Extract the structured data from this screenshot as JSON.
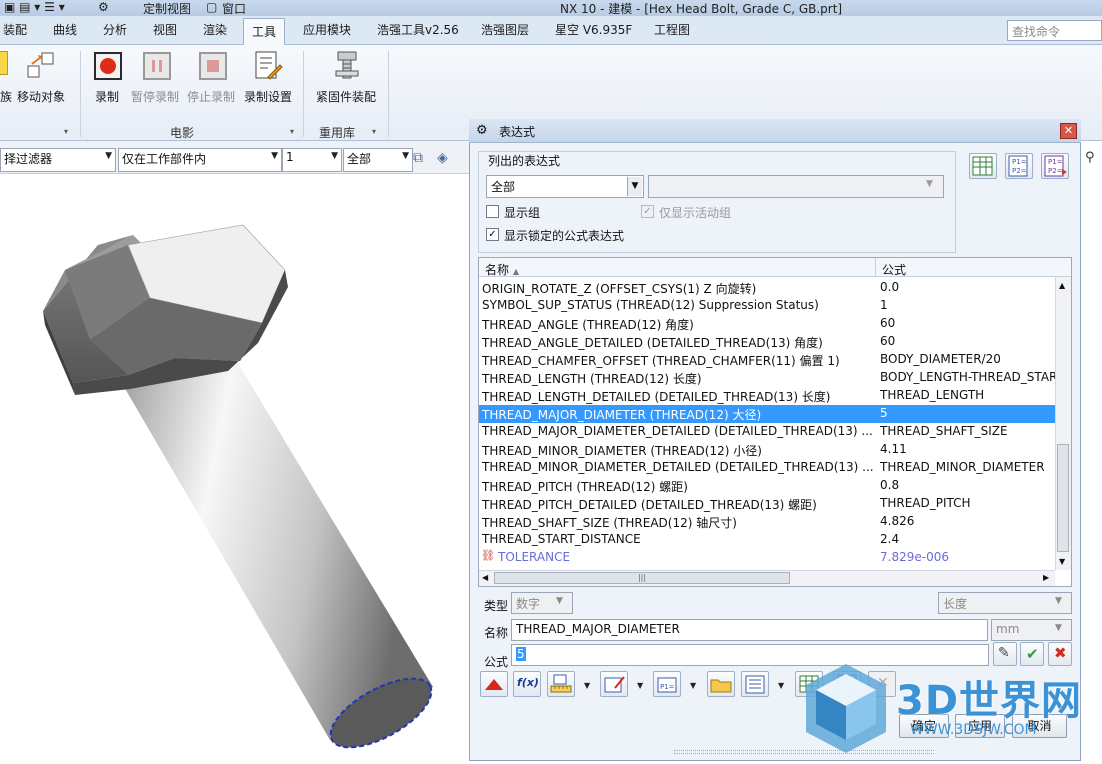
{
  "window": {
    "title": "NX 10 - 建模 - [Hex Head Bolt, Grade C, GB.prt]",
    "quick_access": "定制视图",
    "window_menu": "窗口"
  },
  "tabs": [
    "装配",
    "曲线",
    "分析",
    "视图",
    "渲染",
    "工具",
    "应用模块",
    "浩强工具v2.56",
    "浩强图层",
    "星空 V6.935F",
    "工程图"
  ],
  "active_tab": "工具",
  "command_search": {
    "placeholder": "查找命令"
  },
  "ribbon": {
    "left_labels": [
      "族",
      "移动对象"
    ],
    "movie_group": "电影",
    "movie_buttons": [
      "录制",
      "暂停录制",
      "停止录制",
      "录制设置"
    ],
    "reuse_group": "重用库",
    "reuse_buttons": [
      "紧固件装配"
    ]
  },
  "filter_bar": {
    "type_filter": "择过滤器",
    "scope": "仅在工作部件内",
    "layer": "1",
    "mode": "全部"
  },
  "dialog": {
    "title": "表达式",
    "listed_label": "列出的表达式",
    "listed_value": "全部",
    "show_groups": "显示组",
    "show_active_only": "仅显示活动组",
    "show_locked": "显示锁定的公式表达式",
    "col_name": "名称",
    "col_formula": "公式",
    "rows": [
      {
        "name": "ORIGIN_ROTATE_Z  (OFFSET_CSYS(1) Z 向旋转)",
        "formula": "0.0"
      },
      {
        "name": "SYMBOL_SUP_STATUS  (THREAD(12) Suppression Status)",
        "formula": "1"
      },
      {
        "name": "THREAD_ANGLE  (THREAD(12) 角度)",
        "formula": "60"
      },
      {
        "name": "THREAD_ANGLE_DETAILED  (DETAILED_THREAD(13) 角度)",
        "formula": "60"
      },
      {
        "name": "THREAD_CHAMFER_OFFSET  (THREAD_CHAMFER(11) 偏置 1)",
        "formula": "BODY_DIAMETER/20"
      },
      {
        "name": "THREAD_LENGTH  (THREAD(12) 长度)",
        "formula": "BODY_LENGTH-THREAD_STAR"
      },
      {
        "name": "THREAD_LENGTH_DETAILED  (DETAILED_THREAD(13) 长度)",
        "formula": "THREAD_LENGTH"
      },
      {
        "name": "THREAD_MAJOR_DIAMETER  (THREAD(12) 大径)",
        "formula": "5"
      },
      {
        "name": "THREAD_MAJOR_DIAMETER_DETAILED  (DETAILED_THREAD(13) ...",
        "formula": "THREAD_SHAFT_SIZE"
      },
      {
        "name": "THREAD_MINOR_DIAMETER  (THREAD(12) 小径)",
        "formula": "4.11"
      },
      {
        "name": "THREAD_MINOR_DIAMETER_DETAILED  (DETAILED_THREAD(13) ...",
        "formula": "THREAD_MINOR_DIAMETER"
      },
      {
        "name": "THREAD_PITCH  (THREAD(12) 螺距)",
        "formula": "0.8"
      },
      {
        "name": "THREAD_PITCH_DETAILED  (DETAILED_THREAD(13) 螺距)",
        "formula": "THREAD_PITCH"
      },
      {
        "name": "THREAD_SHAFT_SIZE  (THREAD(12) 轴尺寸)",
        "formula": "4.826"
      },
      {
        "name": "THREAD_START_DISTANCE",
        "formula": "2.4"
      },
      {
        "name": "TOLERANCE",
        "formula": "7.829e-006"
      }
    ],
    "selected_index": 7,
    "type_label": "类型",
    "type_value": "数字",
    "dimension_value": "长度",
    "name_label": "名称",
    "name_value": "THREAD_MAJOR_DIAMETER",
    "unit_value": "mm",
    "formula_label": "公式",
    "formula_value": "5",
    "bottom_buttons": [
      "确定",
      "应用",
      "取消"
    ]
  },
  "watermark": {
    "brand": "3D世界网",
    "url": "WWW.3DSJW.COM"
  }
}
